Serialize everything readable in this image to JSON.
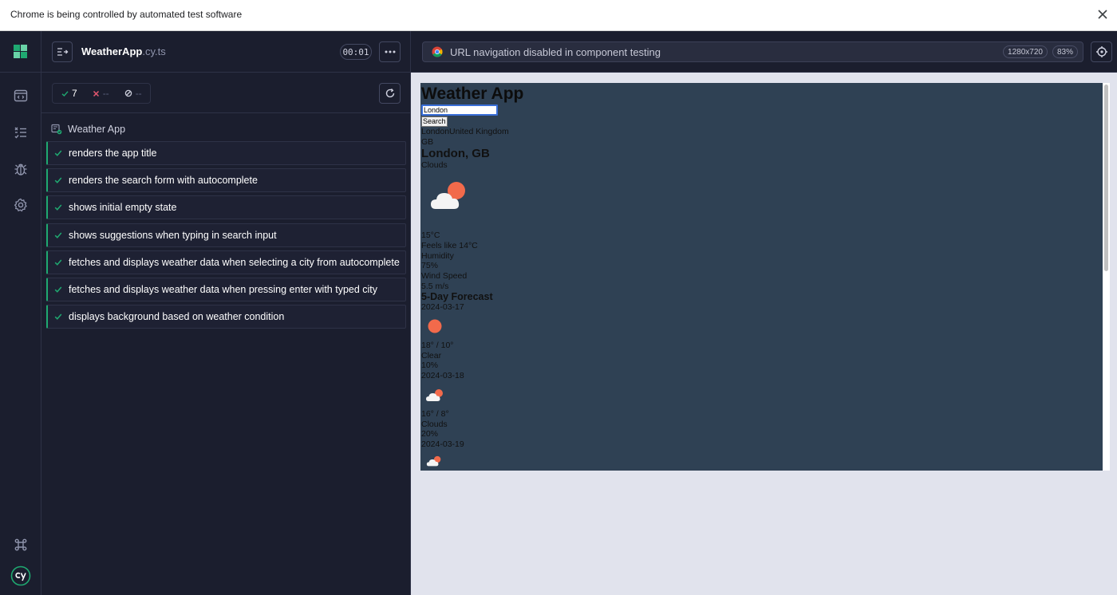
{
  "banner": {
    "text": "Chrome is being controlled by automated test software"
  },
  "header": {
    "spec_name": "WeatherApp",
    "spec_ext": ".cy.ts",
    "timer": "00:01"
  },
  "stats": {
    "passed": "7",
    "failed": "--",
    "pending": "--"
  },
  "suite": {
    "title": "Weather App"
  },
  "tests": [
    {
      "title": "renders the app title"
    },
    {
      "title": "renders the search form with autocomplete"
    },
    {
      "title": "shows initial empty state"
    },
    {
      "title": "shows suggestions when typing in search input"
    },
    {
      "title": "fetches and displays weather data when selecting a city from autocomplete"
    },
    {
      "title": "fetches and displays weather data when pressing enter with typed city"
    },
    {
      "title": "displays background based on weather condition"
    }
  ],
  "url_bar": {
    "text": "URL navigation disabled in component testing",
    "viewport": "1280x720",
    "zoom": "83%"
  },
  "app": {
    "title": "Weather App",
    "search_value": "London",
    "search_button": "Search",
    "suggestion": "LondonUnited Kingdom",
    "suggestion_country": "GB",
    "location": "London, GB",
    "condition": "Clouds",
    "temperature": "15°C",
    "feels_like": "Feels like 14°C",
    "humidity_label": "Humidity",
    "humidity_value": "75%",
    "wind_label": "Wind Speed",
    "wind_value": "5.5 m/s",
    "forecast_title": "5-Day Forecast",
    "forecast": [
      {
        "date": "2024-03-17",
        "icon": "sun-icon",
        "temps": "18° / 10°",
        "condition": "Clear",
        "precip": "10%"
      },
      {
        "date": "2024-03-18",
        "icon": "cloud-sun-icon",
        "temps": "16° / 8°",
        "condition": "Clouds",
        "precip": "20%"
      },
      {
        "date": "2024-03-19",
        "icon": "cloud-sun-icon"
      }
    ]
  },
  "colors": {
    "accent_green": "#1fa971",
    "aut_background": "#2f4154",
    "sun": "#f26a4b"
  }
}
